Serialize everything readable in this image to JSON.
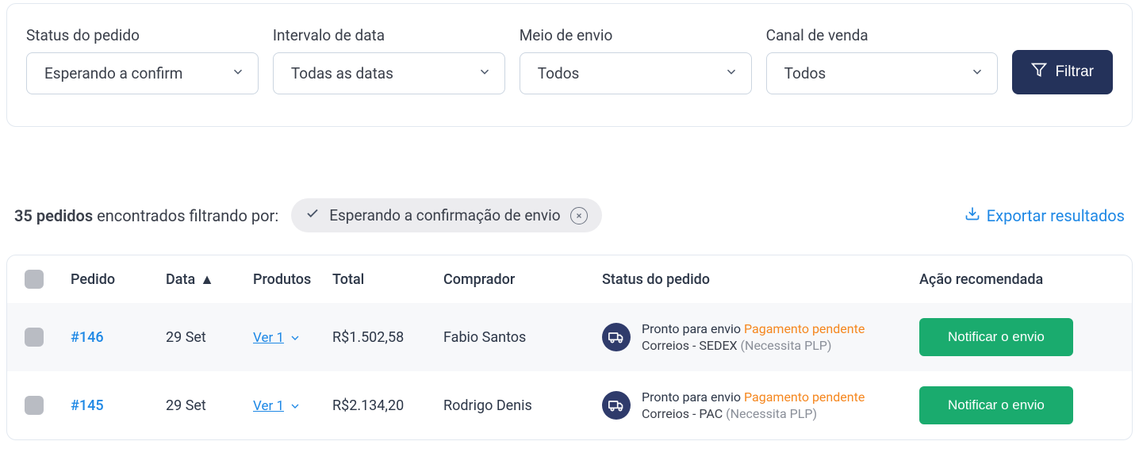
{
  "filters": {
    "status": {
      "label": "Status do pedido",
      "value": "Esperando a confirm"
    },
    "date": {
      "label": "Intervalo de data",
      "value": "Todas as datas"
    },
    "ship": {
      "label": "Meio de envio",
      "value": "Todos"
    },
    "channel": {
      "label": "Canal de venda",
      "value": "Todos"
    },
    "filter_button": "Filtrar"
  },
  "summary": {
    "count": "35 pedidos",
    "found_text": "encontrados filtrando por:",
    "chip": "Esperando a confirmação de envio",
    "export": "Exportar resultados"
  },
  "headers": {
    "order": "Pedido",
    "date": "Data",
    "products": "Produtos",
    "total": "Total",
    "buyer": "Comprador",
    "status": "Status do pedido",
    "action": "Ação recomendada"
  },
  "rows": [
    {
      "order": "#146",
      "date": "29 Set",
      "products": "Ver 1",
      "total": "R$1.502,58",
      "buyer": "Fabio Santos",
      "status_l1a": "Pronto para envio",
      "status_l1b": "Pagamento pendente",
      "status_l2a": "Correios - SEDEX",
      "status_l2b": "(Necessita PLP)",
      "action": "Notificar o envio"
    },
    {
      "order": "#145",
      "date": "29 Set",
      "products": "Ver 1",
      "total": "R$2.134,20",
      "buyer": "Rodrigo Denis",
      "status_l1a": "Pronto para envio",
      "status_l1b": "Pagamento pendente",
      "status_l2a": "Correios - PAC",
      "status_l2b": "(Necessita PLP)",
      "action": "Notificar o envio"
    }
  ]
}
